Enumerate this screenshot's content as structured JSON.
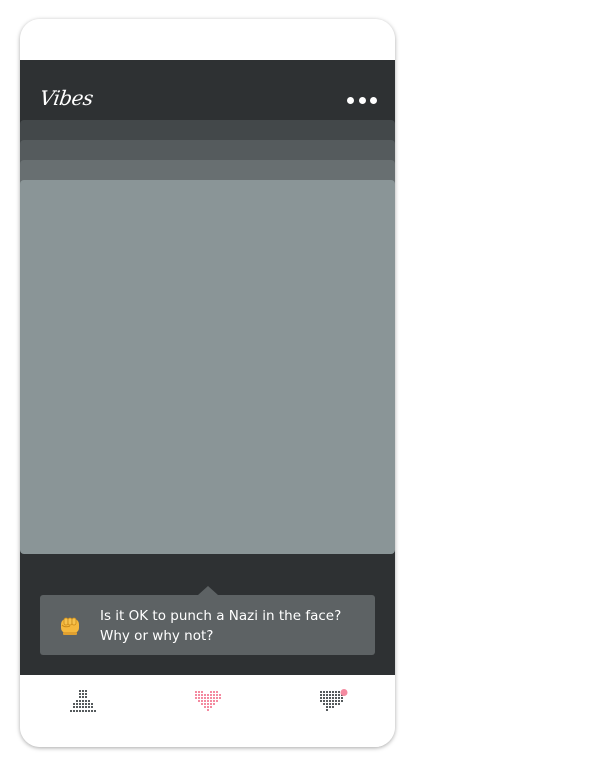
{
  "header": {
    "logo_text": "Vibes",
    "more_icon": "more-dots-icon"
  },
  "prompt": {
    "emoji_icon": "fist-icon",
    "line1": "Is it OK to punch a Nazi in the face?",
    "line2": "Why or why not?"
  },
  "tabs": [
    {
      "icon": "profile-icon",
      "active": false
    },
    {
      "icon": "heart-icon",
      "active": true
    },
    {
      "icon": "chat-heart-icon",
      "active": false,
      "has_notification": true
    }
  ],
  "colors": {
    "app_background": "#2e3133",
    "card": "#8a9597",
    "bubble": "#5d6264",
    "accent_pink": "#f48aa0",
    "icon_gray": "#555a5c"
  }
}
